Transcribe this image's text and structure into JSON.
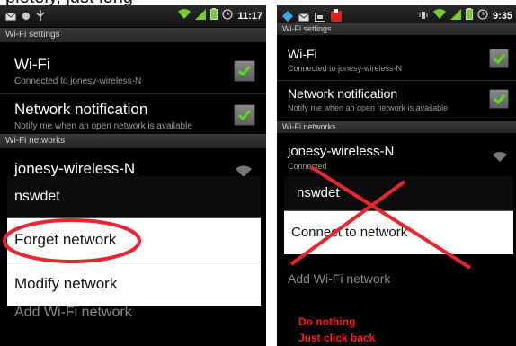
{
  "caption": "pletely, just long-",
  "left": {
    "time": "11:17",
    "wifi_settings_header": "Wi-Fi settings",
    "wifi_title": "Wi-Fi",
    "wifi_summary": "Connected to jonesy-wireless-N",
    "netnotif_title": "Network notification",
    "netnotif_summary": "Notify me when an open network is available",
    "networks_header": "Wi-Fi networks",
    "network_name": "jonesy-wireless-N",
    "dialog_title": "nswdet",
    "forget_label": "Forget network",
    "modify_label": "Modify network",
    "add_network": "Add Wi-Fi network"
  },
  "right": {
    "time": "9:35",
    "wifi_settings_header": "Wi-Fi settings",
    "wifi_title": "Wi-Fi",
    "wifi_summary": "Connected to jonesy-wireless-N",
    "netnotif_title": "Network notification",
    "netnotif_summary": "Notify me when an open network is available",
    "networks_header": "Wi-Fi networks",
    "network_name": "jonesy-wireless-N",
    "network_status": "Connected",
    "dialog_title": "nswdet",
    "connect_label": "Connect to network",
    "add_network": "Add Wi-Fi network",
    "note_line1": "Do nothing",
    "note_line2": "Just click back"
  },
  "colors": {
    "highlight_circle": "#e8262e",
    "cross": "#e8262e",
    "status_green": "#7acc29",
    "note": "#ff1a1a"
  }
}
